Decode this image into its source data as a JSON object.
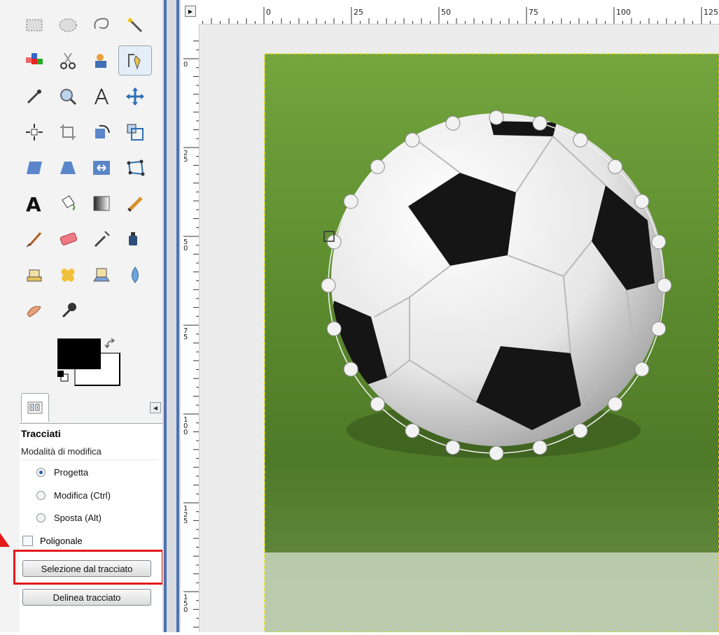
{
  "toolbox": {
    "tools": [
      {
        "name": "rect-select-icon"
      },
      {
        "name": "ellipse-select-icon"
      },
      {
        "name": "free-select-icon"
      },
      {
        "name": "fuzzy-select-icon"
      },
      {
        "name": "color-select-icon"
      },
      {
        "name": "scissors-select-icon"
      },
      {
        "name": "foreground-select-icon"
      },
      {
        "name": "paths-tool-icon",
        "active": true
      },
      {
        "name": "color-picker-icon"
      },
      {
        "name": "zoom-icon"
      },
      {
        "name": "measure-icon"
      },
      {
        "name": "move-icon"
      },
      {
        "name": "align-icon"
      },
      {
        "name": "crop-icon"
      },
      {
        "name": "rotate-icon"
      },
      {
        "name": "scale-icon"
      },
      {
        "name": "shear-icon"
      },
      {
        "name": "perspective-icon"
      },
      {
        "name": "flip-icon"
      },
      {
        "name": "cage-transform-icon"
      },
      {
        "name": "text-icon"
      },
      {
        "name": "bucket-fill-icon"
      },
      {
        "name": "blend-icon"
      },
      {
        "name": "pencil-icon"
      },
      {
        "name": "paintbrush-icon"
      },
      {
        "name": "eraser-icon"
      },
      {
        "name": "airbrush-icon"
      },
      {
        "name": "ink-icon"
      },
      {
        "name": "clone-icon"
      },
      {
        "name": "heal-icon"
      },
      {
        "name": "perspective-clone-icon"
      },
      {
        "name": "blur-icon"
      },
      {
        "name": "smudge-icon"
      },
      {
        "name": "dodge-burn-icon"
      }
    ],
    "colors": {
      "foreground": "#000000",
      "background": "#ffffff"
    }
  },
  "tool_options": {
    "title": "Tracciati",
    "mode_label": "Modalità di modifica",
    "modes": [
      {
        "label": "Progetta",
        "selected": true
      },
      {
        "label": "Modifica (Ctrl)",
        "selected": false
      },
      {
        "label": "Sposta (Alt)",
        "selected": false
      }
    ],
    "polygonal_label": "Poligonale",
    "selection_button": "Selezione dal tracciato",
    "stroke_button": "Delinea tracciato"
  },
  "ruler_top": {
    "labels": [
      "0",
      "25",
      "50",
      "75",
      "100",
      "125"
    ]
  },
  "ruler_left": {
    "labels": [
      "0",
      "25",
      "50",
      "75",
      "100",
      "125",
      "150"
    ]
  },
  "colors": {
    "highlight": "#e31a1a",
    "accent": "#2062b5",
    "grass": "#4f7a28",
    "divider": "#4d72b0"
  }
}
